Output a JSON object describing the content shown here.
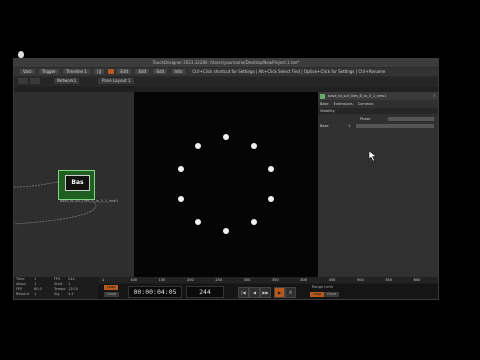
{
  "window": {
    "title": "TouchDesigner 2023.32280: /Users/yourname/Desktop/NewProject.1.toe*"
  },
  "menubar": {
    "items": [
      "Varz",
      "Trigger",
      "Timeline 1",
      "|||",
      "Raw",
      "",
      "Edit",
      "Edit",
      "Edit",
      "Info"
    ],
    "path": "Ctrl+Click shortcut for Settings | Alt+Click Select Find | Option+Click for Settings | Ctrl+Rename"
  },
  "tabs": {
    "left": "Network1",
    "right": "Pane Layout 1"
  },
  "node": {
    "title": "Bas",
    "label": "base_to_suf_tiles_B_to_5_1_new1"
  },
  "params": {
    "header": "base_to_suf_tiles_B_to_5_1_new1",
    "tabs": [
      "Base",
      "Extensions",
      "Common"
    ],
    "section": "Visibility",
    "rows": [
      {
        "label": "Phase",
        "value": ""
      },
      {
        "label": "Base",
        "value": "1"
      }
    ]
  },
  "stats": {
    "rows": [
      [
        "Time",
        "1",
        "FPS",
        "244"
      ],
      [
        "Absol",
        "1",
        "Start",
        "1"
      ],
      [
        "FPS",
        "60.0",
        "Tempo",
        "120.0"
      ],
      [
        "Resolut",
        "1",
        "Sig",
        "4   4"
      ]
    ]
  },
  "transport": {
    "timecode": "00:00:04:05",
    "frame": "244",
    "range_label": "Range Limit",
    "buttons": [
      "|◀",
      "◀",
      "▶▶",
      "▶",
      "II"
    ],
    "left_buttons": [
      "Loop",
      "Once"
    ],
    "right_buttons": [
      "Loop",
      "Once"
    ]
  },
  "ruler": {
    "ticks": [
      "1",
      "100",
      "150",
      "200",
      "250",
      "300",
      "350",
      "400",
      "450",
      "500",
      "550",
      "600"
    ]
  },
  "viewer": {
    "dot_count": 10
  }
}
